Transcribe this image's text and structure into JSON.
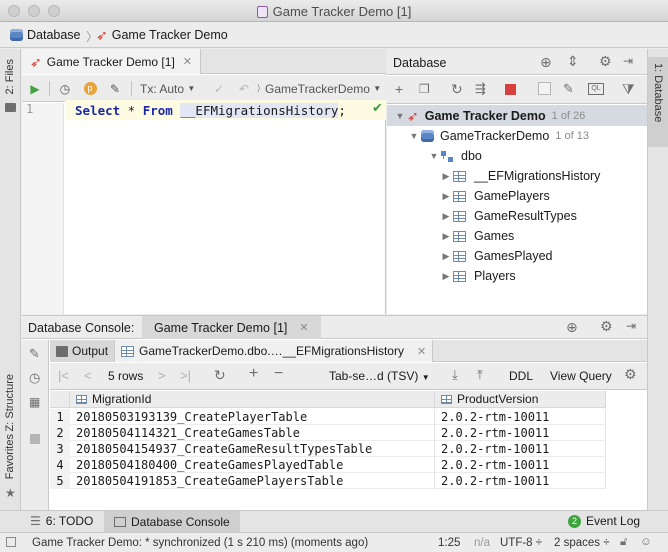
{
  "window": {
    "title": "Game Tracker Demo [1]"
  },
  "breadcrumb": {
    "items": [
      "Database",
      "Game Tracker Demo"
    ]
  },
  "left_strip": {
    "files_tab": "2: Files",
    "structure_tab": "Z: Structure",
    "favorites_tab": "Favorites"
  },
  "right_strip": {
    "database_tab": "1: Database"
  },
  "editor": {
    "tab_label": "Game Tracker Demo [1]",
    "tx_mode": "Tx: Auto",
    "schema_selector": "GameTrackerDemo",
    "line_number": "1",
    "code": {
      "kw_select": "Select",
      "star": " * ",
      "kw_from": "From",
      "table": "__EFMigrationsHistory",
      "end": ";"
    }
  },
  "database": {
    "title": "Database",
    "tree": {
      "datasource": {
        "label": "Game Tracker Demo",
        "count": "1 of 26"
      },
      "database": {
        "label": "GameTrackerDemo",
        "count": "1 of 13"
      },
      "schema": {
        "label": "dbo"
      },
      "tables": [
        "__EFMigrationsHistory",
        "GamePlayers",
        "GameResultTypes",
        "Games",
        "GamesPlayed",
        "Players"
      ]
    }
  },
  "console": {
    "header_label": "Database Console:",
    "header_tab": "Game Tracker Demo [1]",
    "tab_output": "Output",
    "tab_result": "GameTrackerDemo.dbo.…__EFMigrationsHistory",
    "rows_label": "5 rows",
    "format_label": "Tab-se…d (TSV)",
    "ddl_label": "DDL",
    "view_query_label": "View Query",
    "columns": [
      "MigrationId",
      "ProductVersion"
    ],
    "rows": [
      {
        "n": "1",
        "id": "20180503193139_CreatePlayerTable",
        "ver": "2.0.2-rtm-10011"
      },
      {
        "n": "2",
        "id": "20180504114321_CreateGamesTable",
        "ver": "2.0.2-rtm-10011"
      },
      {
        "n": "3",
        "id": "20180504154937_CreateGameResultTypesTable",
        "ver": "2.0.2-rtm-10011"
      },
      {
        "n": "4",
        "id": "20180504180400_CreateGamesPlayedTable",
        "ver": "2.0.2-rtm-10011"
      },
      {
        "n": "5",
        "id": "20180504191853_CreateGamePlayersTable",
        "ver": "2.0.2-rtm-10011"
      }
    ]
  },
  "bottom_tabs": {
    "todo": "6: TODO",
    "db_console": "Database Console",
    "event_log": "Event Log",
    "event_count": "2"
  },
  "status": {
    "message": "Game Tracker Demo: * synchronized (1 s 210 ms) (moments ago)",
    "position": "1:25",
    "na": "n/a",
    "encoding": "UTF-8 ÷",
    "indent": "2 spaces ÷"
  },
  "colors": {
    "accent_red": "#d3382b",
    "run_green": "#3fa33f",
    "stop_red": "#d84040",
    "selection": "#d5d9e0",
    "keyword_blue": "#1a28a4"
  }
}
